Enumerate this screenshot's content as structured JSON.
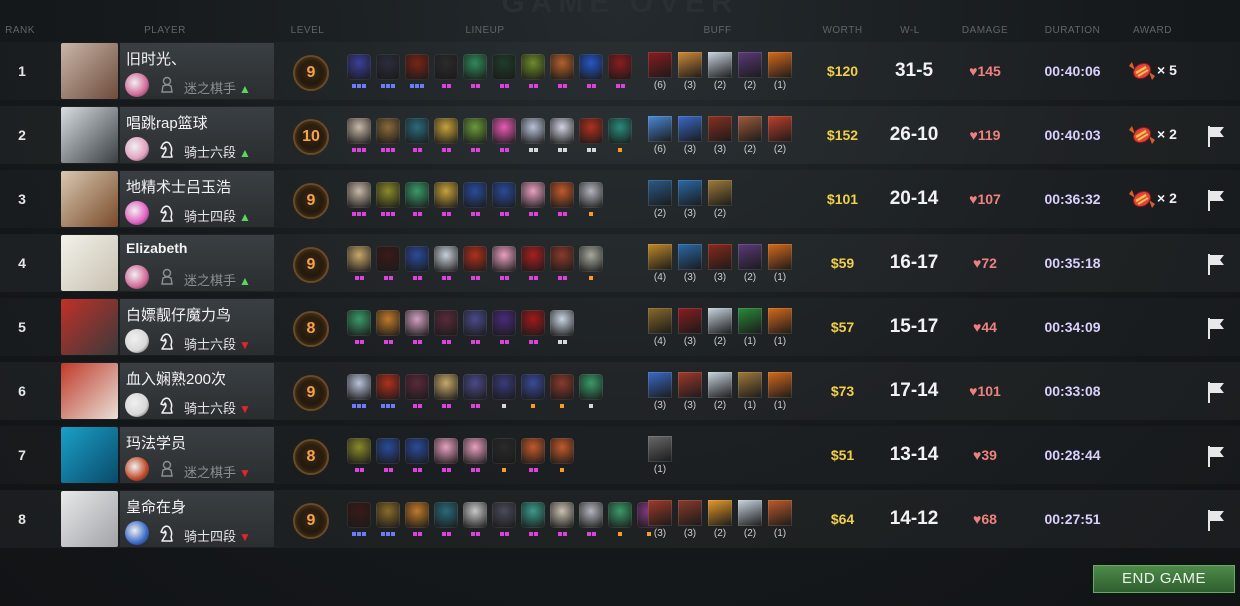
{
  "title_ghost": "GAME OVER",
  "headers": {
    "rank": "RANK",
    "player": "PLAYER",
    "level": "LEVEL",
    "lineup": "LINEUP",
    "buff": "BUFF",
    "worth": "WORTH",
    "wl": "W-L",
    "damage": "DAMAGE",
    "duration": "DURATION",
    "award": "AWARD"
  },
  "rows": [
    {
      "rank": "1",
      "name": "旧时光、",
      "rank_title": "迷之棋手",
      "rank_dim": true,
      "trend": "▲",
      "trend_dir": "up",
      "avatar_colors": [
        "#c9b6a8",
        "#6d4b3b"
      ],
      "mini_color": "#d26a9a",
      "level": "9",
      "lineup": [
        {
          "c": "#3b3f9a",
          "s": 3,
          "sc": "#6f7bff"
        },
        {
          "c": "#2a2d3c",
          "s": 3,
          "sc": "#6f7bff"
        },
        {
          "c": "#7a2418",
          "s": 3,
          "sc": "#6f7bff"
        },
        {
          "c": "#2b2b2b",
          "s": 2,
          "sc": "#e040e0"
        },
        {
          "c": "#2f8a5a",
          "s": 2,
          "sc": "#e040e0"
        },
        {
          "c": "#1f3c2a",
          "s": 2,
          "sc": "#e040e0"
        },
        {
          "c": "#6f8a2a",
          "s": 2,
          "sc": "#e040e0"
        },
        {
          "c": "#b4602b",
          "s": 2,
          "sc": "#e040e0"
        },
        {
          "c": "#2556c7",
          "s": 2,
          "sc": "#e040e0"
        },
        {
          "c": "#8a1c20",
          "s": 2,
          "sc": "#e040e0"
        }
      ],
      "buffs": [
        {
          "c": "#8a1c20",
          "n": "(6)"
        },
        {
          "c": "#d08a3a",
          "n": "(3)"
        },
        {
          "c": "#c9d4e0",
          "n": "(2)"
        },
        {
          "c": "#5a3a7a",
          "n": "(2)"
        },
        {
          "c": "#d86a1a",
          "n": "(1)"
        }
      ],
      "worth": "$120",
      "wl": "31-5",
      "damage": "♥145",
      "duration": "00:40:06",
      "award": "× 5",
      "has_flag": false
    },
    {
      "rank": "2",
      "name": "唱跳rap篮球",
      "rank_title": "骑士六段",
      "rank_dim": false,
      "trend": "▲",
      "trend_dir": "up",
      "avatar_colors": [
        "#d8dde2",
        "#3a3f44"
      ],
      "mini_color": "#e0a0c0",
      "level": "10",
      "lineup": [
        {
          "c": "#c9b8a8",
          "s": 3,
          "sc": "#e040e0"
        },
        {
          "c": "#8a6a3a",
          "s": 3,
          "sc": "#e040e0"
        },
        {
          "c": "#2a6a7a",
          "s": 2,
          "sc": "#e040e0"
        },
        {
          "c": "#c7a23a",
          "s": 2,
          "sc": "#e040e0"
        },
        {
          "c": "#6a9a3a",
          "s": 2,
          "sc": "#e040e0"
        },
        {
          "c": "#e85ab4",
          "s": 2,
          "sc": "#e040e0"
        },
        {
          "c": "#b8c2d8",
          "s": 2,
          "sc": "#d8d8d8"
        },
        {
          "c": "#d0d4e0",
          "s": 2,
          "sc": "#d8d8d8"
        },
        {
          "c": "#b0301e",
          "s": 2,
          "sc": "#d8d8d8"
        },
        {
          "c": "#2a8a7a",
          "s": 1,
          "sc": "#ff9a20"
        }
      ],
      "buffs": [
        {
          "c": "#4a8ad8",
          "n": "(6)"
        },
        {
          "c": "#3a6ac8",
          "n": "(3)"
        },
        {
          "c": "#8a3020",
          "n": "(3)"
        },
        {
          "c": "#a05a3a",
          "n": "(2)"
        },
        {
          "c": "#c0402a",
          "n": "(2)"
        }
      ],
      "worth": "$152",
      "wl": "26-10",
      "damage": "♥119",
      "duration": "00:40:03",
      "award": "× 2",
      "has_flag": true
    },
    {
      "rank": "3",
      "name": "地精术士吕玉浩",
      "rank_title": "骑士四段",
      "rank_dim": false,
      "trend": "▲",
      "trend_dir": "up",
      "avatar_colors": [
        "#d8c8b0",
        "#7a4a2a"
      ],
      "mini_color": "#e060c0",
      "level": "9",
      "lineup": [
        {
          "c": "#c9b8a8",
          "s": 3,
          "sc": "#e040e0"
        },
        {
          "c": "#8a8a2a",
          "s": 3,
          "sc": "#e040e0"
        },
        {
          "c": "#3a9a6a",
          "s": 2,
          "sc": "#e040e0"
        },
        {
          "c": "#c7a23a",
          "s": 2,
          "sc": "#e040e0"
        },
        {
          "c": "#2a4a9a",
          "s": 2,
          "sc": "#e040e0"
        },
        {
          "c": "#2a4a9a",
          "s": 2,
          "sc": "#e040e0"
        },
        {
          "c": "#e8a0c0",
          "s": 2,
          "sc": "#e040e0"
        },
        {
          "c": "#c05a2a",
          "s": 2,
          "sc": "#e040e0"
        },
        {
          "c": "#b0b4bc",
          "s": 1,
          "sc": "#ff9a20"
        }
      ],
      "buffs": [
        {
          "c": "#2a5a8a",
          "n": "(2)"
        },
        {
          "c": "#2a6aa8",
          "n": "(3)"
        },
        {
          "c": "#a07a3a",
          "n": "(2)"
        }
      ],
      "worth": "$101",
      "wl": "20-14",
      "damage": "♥107",
      "duration": "00:36:32",
      "award": "× 2",
      "has_flag": true
    },
    {
      "rank": "4",
      "name": "Elizabeth",
      "name_bold": true,
      "rank_title": "迷之棋手",
      "rank_dim": true,
      "trend": "▲",
      "trend_dir": "up",
      "avatar_colors": [
        "#f2f2ea",
        "#c8c0b0"
      ],
      "mini_color": "#d26a9a",
      "level": "9",
      "lineup": [
        {
          "c": "#c8a86a",
          "s": 2,
          "sc": "#e040e0"
        },
        {
          "c": "#3a1a1a",
          "s": 2,
          "sc": "#e040e0"
        },
        {
          "c": "#2a4a9a",
          "s": 2,
          "sc": "#e040e0"
        },
        {
          "c": "#c8d0d8",
          "s": 2,
          "sc": "#e040e0"
        },
        {
          "c": "#b0301e",
          "s": 2,
          "sc": "#e040e0"
        },
        {
          "c": "#e8a0c0",
          "s": 2,
          "sc": "#e040e0"
        },
        {
          "c": "#a82020",
          "s": 2,
          "sc": "#e040e0"
        },
        {
          "c": "#8a3a2a",
          "s": 2,
          "sc": "#e040e0"
        },
        {
          "c": "#a8a8a0",
          "s": 1,
          "sc": "#ff9a20"
        }
      ],
      "buffs": [
        {
          "c": "#c08a2a",
          "n": "(4)"
        },
        {
          "c": "#2a6aa8",
          "n": "(3)"
        },
        {
          "c": "#8a2a1a",
          "n": "(3)"
        },
        {
          "c": "#5a3a7a",
          "n": "(2)"
        },
        {
          "c": "#d86a1a",
          "n": "(1)"
        }
      ],
      "worth": "$59",
      "wl": "16-17",
      "damage": "♥72",
      "duration": "00:35:18",
      "award": "",
      "has_flag": true
    },
    {
      "rank": "5",
      "name": "白嫖靓仔魔力鸟",
      "rank_title": "骑士六段",
      "rank_dim": false,
      "trend": "▼",
      "trend_dir": "down",
      "avatar_colors": [
        "#c0302a",
        "#3a3a3a"
      ],
      "mini_color": "#d8d8d8",
      "level": "8",
      "lineup": [
        {
          "c": "#3a9a6a",
          "s": 2,
          "sc": "#e040e0"
        },
        {
          "c": "#c07a2a",
          "s": 2,
          "sc": "#e040e0"
        },
        {
          "c": "#d0a0c0",
          "s": 2,
          "sc": "#e040e0"
        },
        {
          "c": "#5a2a3a",
          "s": 2,
          "sc": "#e040e0"
        },
        {
          "c": "#4a4a8a",
          "s": 2,
          "sc": "#e040e0"
        },
        {
          "c": "#4a2a7a",
          "s": 2,
          "sc": "#e040e0"
        },
        {
          "c": "#a01a1a",
          "s": 2,
          "sc": "#e040e0"
        },
        {
          "c": "#c8d4e0",
          "s": 2,
          "sc": "#d8d8d8"
        }
      ],
      "buffs": [
        {
          "c": "#8a6a2a",
          "n": "(4)"
        },
        {
          "c": "#8a1c20",
          "n": "(3)"
        },
        {
          "c": "#c9d4e0",
          "n": "(2)"
        },
        {
          "c": "#2a8a3a",
          "n": "(1)"
        },
        {
          "c": "#d86a1a",
          "n": "(1)"
        }
      ],
      "worth": "$57",
      "wl": "15-17",
      "damage": "♥44",
      "duration": "00:34:09",
      "award": "",
      "has_flag": true
    },
    {
      "rank": "6",
      "name": "血入娴熟200次",
      "rank_title": "骑士六段",
      "rank_dim": false,
      "trend": "▼",
      "trend_dir": "down",
      "avatar_colors": [
        "#c03a2a",
        "#e8e0d8"
      ],
      "mini_color": "#d8d8d8",
      "level": "9",
      "lineup": [
        {
          "c": "#b8c2d8",
          "s": 3,
          "sc": "#6f7bff"
        },
        {
          "c": "#b0301e",
          "s": 3,
          "sc": "#6f7bff"
        },
        {
          "c": "#5a2a3a",
          "s": 2,
          "sc": "#e040e0"
        },
        {
          "c": "#c8a86a",
          "s": 2,
          "sc": "#e040e0"
        },
        {
          "c": "#4a4a8a",
          "s": 2,
          "sc": "#e040e0"
        },
        {
          "c": "#3a3a7a",
          "s": 1,
          "sc": "#d8d8d8"
        },
        {
          "c": "#3a4a9a",
          "s": 1,
          "sc": "#ff9a20"
        },
        {
          "c": "#8a3a2a",
          "s": 1,
          "sc": "#ff9a20"
        },
        {
          "c": "#3a9a6a",
          "s": 1,
          "sc": "#d8d8d8"
        }
      ],
      "buffs": [
        {
          "c": "#3a6ac8",
          "n": "(3)"
        },
        {
          "c": "#a03a2a",
          "n": "(3)"
        },
        {
          "c": "#c9d4e0",
          "n": "(2)"
        },
        {
          "c": "#a07a3a",
          "n": "(1)"
        },
        {
          "c": "#d86a1a",
          "n": "(1)"
        }
      ],
      "worth": "$73",
      "wl": "17-14",
      "damage": "♥101",
      "duration": "00:33:08",
      "award": "",
      "has_flag": true
    },
    {
      "rank": "7",
      "name": "玛法学员",
      "rank_title": "迷之棋手",
      "rank_dim": true,
      "trend": "▼",
      "trend_dir": "down",
      "avatar_colors": [
        "#1aa0c8",
        "#0a4a6a"
      ],
      "mini_color": "#c04a2a",
      "level": "8",
      "lineup": [
        {
          "c": "#8a8a2a",
          "s": 2,
          "sc": "#e040e0"
        },
        {
          "c": "#2a4a9a",
          "s": 2,
          "sc": "#e040e0"
        },
        {
          "c": "#2a4a9a",
          "s": 2,
          "sc": "#e040e0"
        },
        {
          "c": "#e8a0c0",
          "s": 2,
          "sc": "#e040e0"
        },
        {
          "c": "#e8a0c0",
          "s": 2,
          "sc": "#e040e0"
        },
        {
          "c": "#2a2a2a",
          "s": 1,
          "sc": "#ff9a20"
        },
        {
          "c": "#c05a2a",
          "s": 2,
          "sc": "#e040e0"
        },
        {
          "c": "#c05a2a",
          "s": 1,
          "sc": "#ff9a20"
        }
      ],
      "buffs": [
        {
          "c": "#6a6a6a",
          "n": "(1)"
        }
      ],
      "worth": "$51",
      "wl": "13-14",
      "damage": "♥39",
      "duration": "00:28:44",
      "award": "",
      "has_flag": true
    },
    {
      "rank": "8",
      "name": "皇命在身",
      "rank_title": "骑士四段",
      "rank_dim": false,
      "trend": "▼",
      "trend_dir": "down",
      "avatar_colors": [
        "#e8e8e8",
        "#a0a4a8"
      ],
      "mini_color": "#3a6ac8",
      "level": "9",
      "lineup": [
        {
          "c": "#3a1a1a",
          "s": 3,
          "sc": "#6f7bff"
        },
        {
          "c": "#8a6a2a",
          "s": 3,
          "sc": "#6f7bff"
        },
        {
          "c": "#c07a2a",
          "s": 2,
          "sc": "#e040e0"
        },
        {
          "c": "#2a6a7a",
          "s": 2,
          "sc": "#e040e0"
        },
        {
          "c": "#c8c8c8",
          "s": 2,
          "sc": "#e040e0"
        },
        {
          "c": "#4a4a5a",
          "s": 2,
          "sc": "#e040e0"
        },
        {
          "c": "#3a9a8a",
          "s": 2,
          "sc": "#e040e0"
        },
        {
          "c": "#c8c0b0",
          "s": 2,
          "sc": "#e040e0"
        },
        {
          "c": "#b0b4bc",
          "s": 2,
          "sc": "#e040e0"
        },
        {
          "c": "#3a9a6a",
          "s": 1,
          "sc": "#ff9a20"
        },
        {
          "c": "#8a3a8a",
          "s": 1,
          "sc": "#ff9a20"
        }
      ],
      "buffs": [
        {
          "c": "#a03a2a",
          "n": "(3)"
        },
        {
          "c": "#8a3a2a",
          "n": "(3)"
        },
        {
          "c": "#e89a2a",
          "n": "(2)"
        },
        {
          "c": "#c9d4e0",
          "n": "(2)"
        },
        {
          "c": "#c05a2a",
          "n": "(1)"
        }
      ],
      "worth": "$64",
      "wl": "14-12",
      "damage": "♥68",
      "duration": "00:27:51",
      "award": "",
      "has_flag": true
    }
  ],
  "end_game_label": "END GAME"
}
